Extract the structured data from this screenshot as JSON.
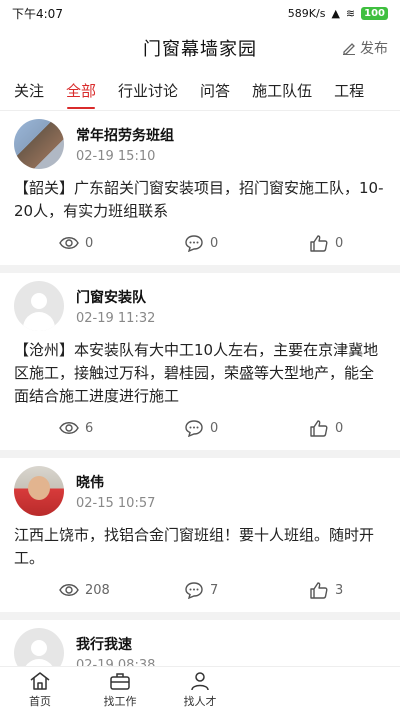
{
  "status_bar": {
    "time": "下午4:07",
    "net_speed": "589K/s",
    "battery": "100"
  },
  "header": {
    "title": "门窗幕墙家园",
    "publish_label": "发布"
  },
  "tabs": [
    {
      "label": "关注"
    },
    {
      "label": "全部"
    },
    {
      "label": "行业讨论"
    },
    {
      "label": "问答"
    },
    {
      "label": "施工队伍"
    },
    {
      "label": "工程"
    }
  ],
  "posts": [
    {
      "author": "常年招劳务班组",
      "date": "02-19 15:10",
      "content": "【韶关】广东韶关门窗安装项目，招门窗安施工队，10-20人，有实力班组联系",
      "views": "0",
      "comments": "0",
      "likes": "0"
    },
    {
      "author": "门窗安装队",
      "date": "02-19 11:32",
      "content": "【沧州】本安装队有大中工10人左右，主要在京津冀地区施工，接触过万科，碧桂园，荣盛等大型地产，能全面结合施工进度进行施工",
      "views": "6",
      "comments": "0",
      "likes": "0"
    },
    {
      "author": "晓伟",
      "date": "02-15 10:57",
      "content": "江西上饶市，找铝合金门窗班组！要十人班组。随时开工。",
      "views": "208",
      "comments": "7",
      "likes": "3"
    },
    {
      "author": "我行我速",
      "date": "02-19 08:38",
      "content": "",
      "views": "",
      "comments": "",
      "likes": ""
    }
  ],
  "bottom_nav": [
    {
      "label": "首页",
      "icon": "home-icon"
    },
    {
      "label": "找工作",
      "icon": "briefcase-icon"
    },
    {
      "label": "找人才",
      "icon": "person-icon"
    },
    {
      "label": "",
      "icon": ""
    },
    {
      "label": "",
      "icon": ""
    }
  ]
}
